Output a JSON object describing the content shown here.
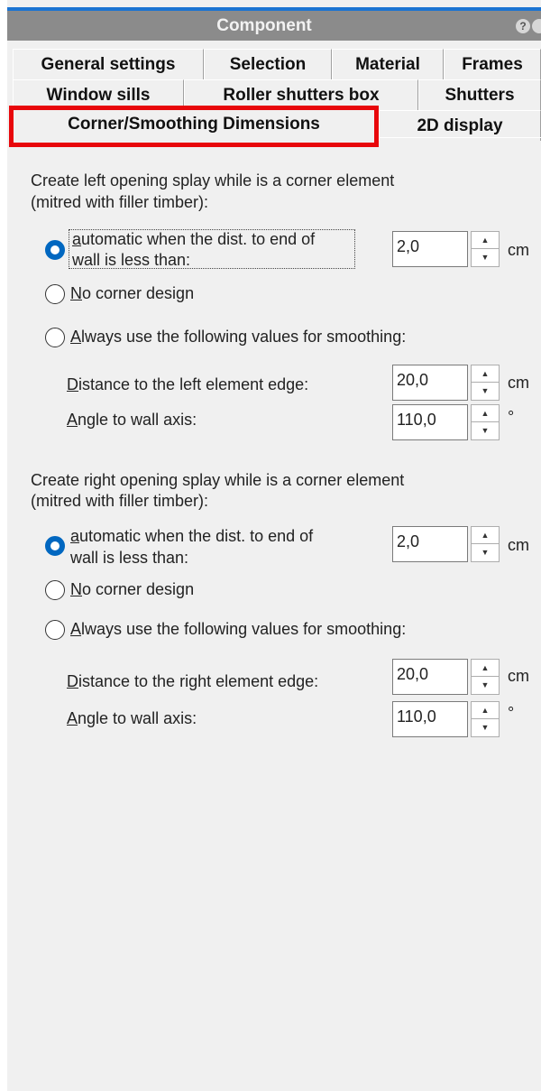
{
  "window": {
    "title": "Component"
  },
  "tabs": {
    "row1": [
      "General settings",
      "Selection",
      "Material",
      "Frames"
    ],
    "row2": [
      "Window sills",
      "Roller shutters box",
      "Shutters"
    ],
    "row3_active": "Corner/Smoothing Dimensions",
    "row3_other": "2D display"
  },
  "left": {
    "heading_line1": "Create left opening splay while is a corner element",
    "heading_line2": "(mitred with filler timber):",
    "auto_line1_key": "a",
    "auto_line1_rest": "utomatic when the dist. to end of",
    "auto_line2": "wall is less than:",
    "auto_value": "2,0",
    "auto_unit": "cm",
    "no_corner_key": "N",
    "no_corner_rest": "o corner design",
    "always_key": "A",
    "always_rest": "lways use the following values for smoothing:",
    "distance_key": "D",
    "distance_rest": "istance to the left element edge:",
    "distance_value": "20,0",
    "distance_unit": "cm",
    "angle_key": "A",
    "angle_rest": "ngle to wall axis:",
    "angle_value": "110,0",
    "angle_unit": "°"
  },
  "right": {
    "heading_line1": "Create right opening splay while is a corner element",
    "heading_line2": "(mitred with filler timber):",
    "auto_line1_key": "a",
    "auto_line1_rest": "utomatic when the dist. to end of",
    "auto_line2": "wall is less than:",
    "auto_value": "2,0",
    "auto_unit": "cm",
    "no_corner_key": "N",
    "no_corner_rest": "o corner design",
    "always_key": "A",
    "always_rest": "lways use the following values for smoothing:",
    "distance_key": "D",
    "distance_rest": "istance to the right element edge:",
    "distance_value": "20,0",
    "distance_unit": "cm",
    "angle_key": "A",
    "angle_rest": "ngle to wall axis:",
    "angle_value": "110,0",
    "angle_unit": "°"
  },
  "icons": {
    "help": "help-icon",
    "spin_up": "spin-up-icon",
    "spin_down": "spin-down-icon",
    "radio": "radio-icon"
  },
  "colors": {
    "title_bar": "#8b8b8b",
    "accent": "#0067c0",
    "highlight": "#e8070b"
  }
}
